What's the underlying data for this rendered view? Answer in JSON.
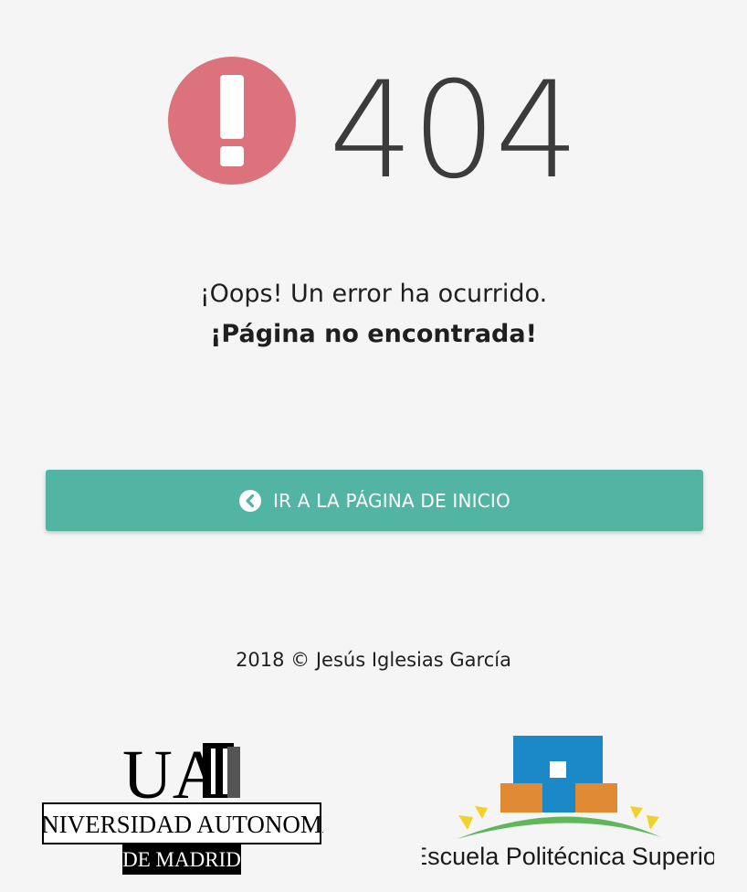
{
  "error": {
    "icon": "exclamation-circle-icon",
    "code": "404",
    "message": "¡Oops! Un error ha ocurrido.",
    "detail": "¡Página no encontrada!"
  },
  "actions": {
    "home_button_icon": "chevron-circle-left-icon",
    "home_button_label": "IR A LA PÁGINA DE INICIO"
  },
  "footer": {
    "copyright": "2018 © Jesús Iglesias García"
  },
  "logos": {
    "uam": {
      "mark": "UAM",
      "name": "UNIVERSIDAD AUTONOMA",
      "subname": "DE MADRID"
    },
    "eps": {
      "name": "Escuela Politécnica Superior"
    }
  },
  "colors": {
    "background": "#f5f5f5",
    "error_icon": "#dc727b",
    "code_text": "#3b3b3b",
    "button": "#52b4a2",
    "eps_blue": "#1b88c8",
    "eps_orange": "#e08a34",
    "eps_green": "#5fb75a",
    "eps_yellow": "#f2d22a"
  }
}
